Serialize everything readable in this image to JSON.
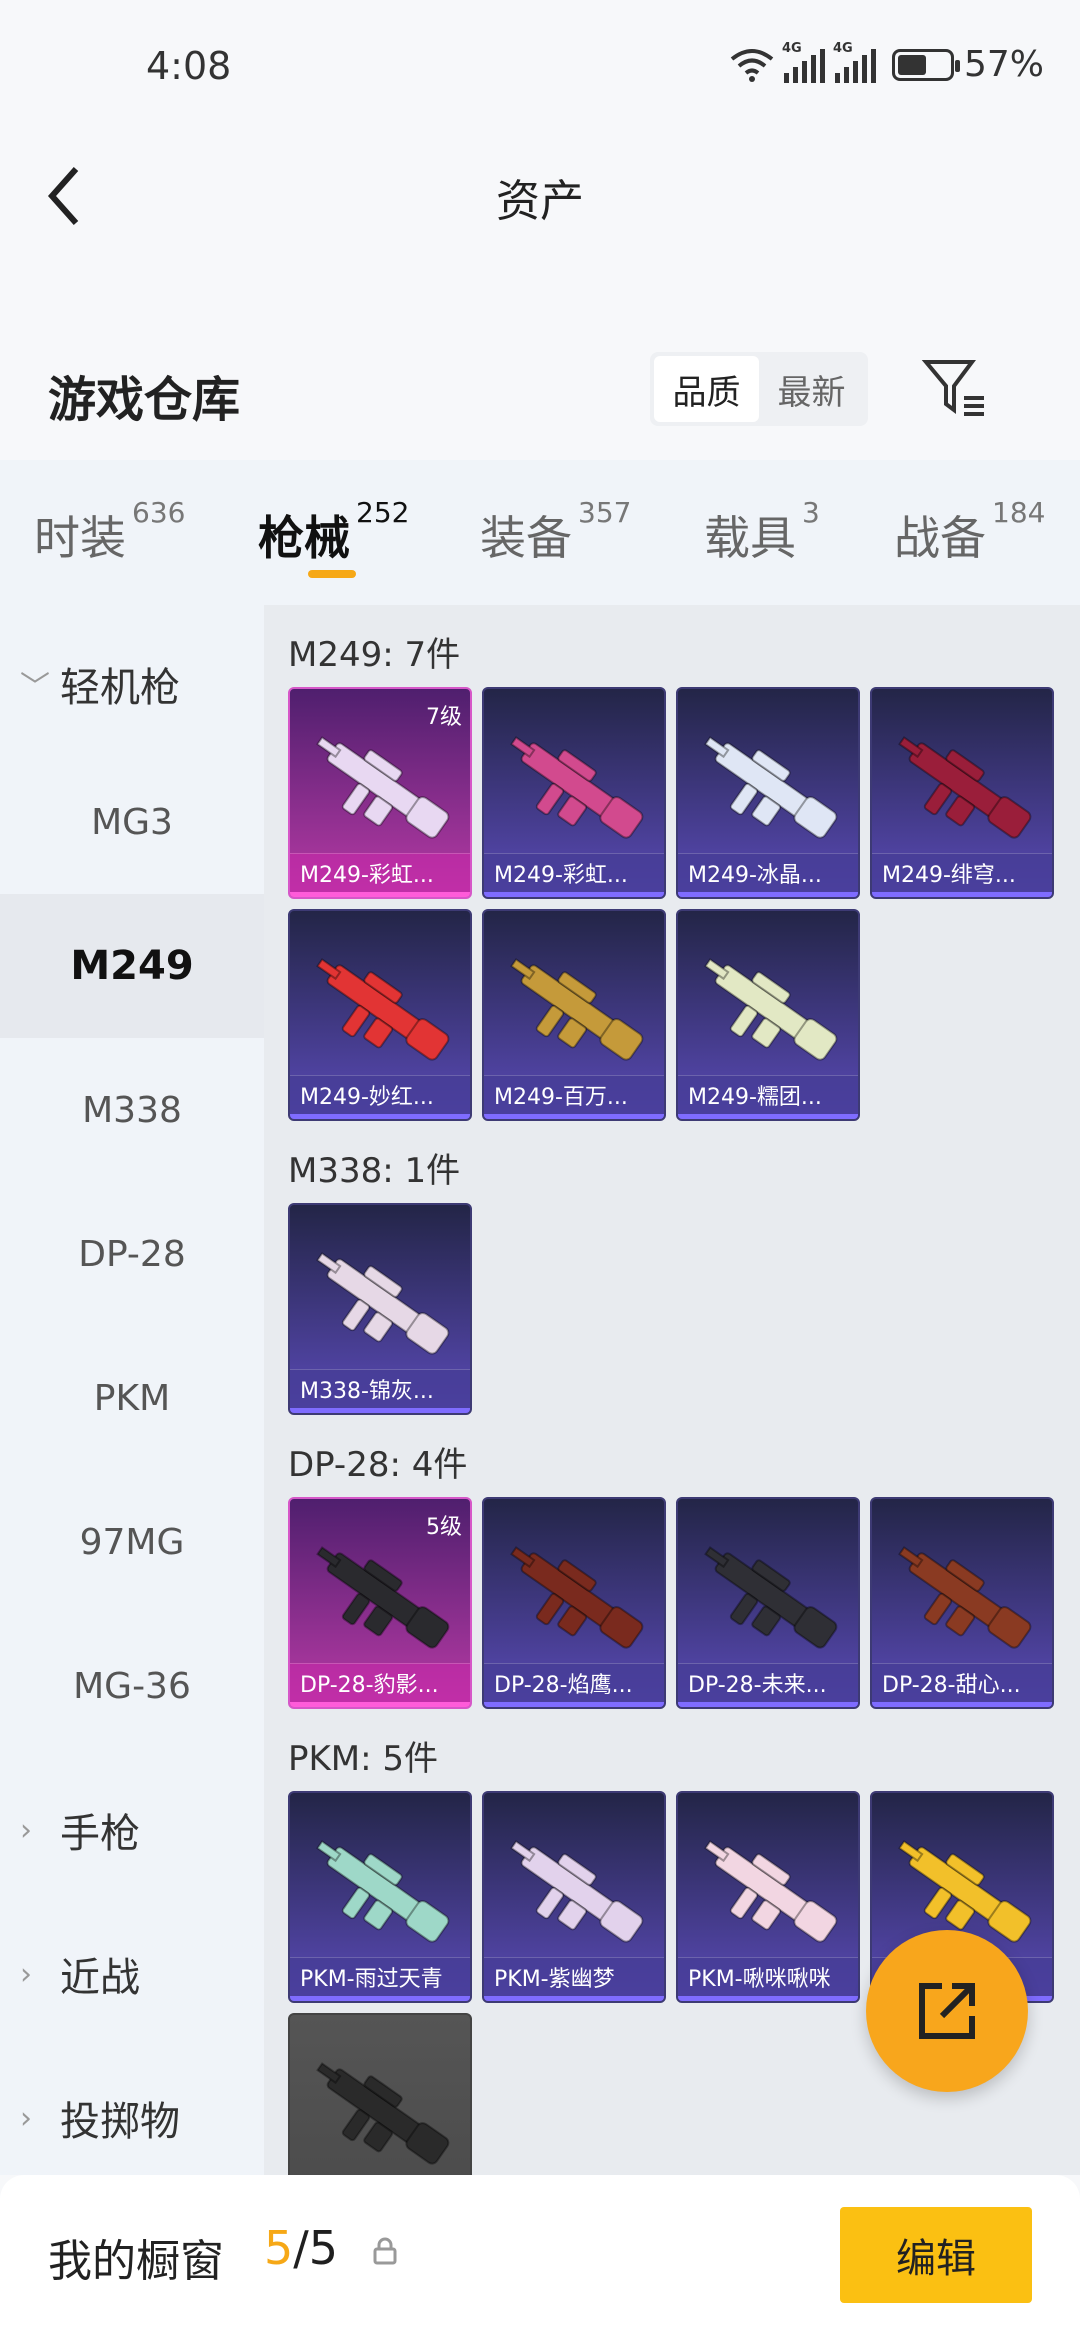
{
  "status": {
    "time": "4:08",
    "net1": "4G",
    "net2": "4G",
    "battery": "57%",
    "battery_level": 0.57
  },
  "header": {
    "title": "资产"
  },
  "warehouse": {
    "title": "游戏仓库",
    "sort_quality": "品质",
    "sort_newest": "最新"
  },
  "tabs": [
    {
      "label": "时装",
      "count": "636"
    },
    {
      "label": "枪械",
      "count": "252"
    },
    {
      "label": "装备",
      "count": "357"
    },
    {
      "label": "载具",
      "count": "3"
    },
    {
      "label": "战备",
      "count": "184"
    }
  ],
  "sidebar": {
    "category_open": "轻机枪",
    "items": [
      "MG3",
      "M249",
      "M338",
      "DP-28",
      "PKM",
      "97MG",
      "MG-36"
    ],
    "selected": "M249",
    "categories_closed": [
      "手枪",
      "近战",
      "投掷物"
    ]
  },
  "groups": [
    {
      "title": "M249: 7件",
      "items": [
        {
          "name": "M249-彩虹...",
          "level": "7级",
          "tier": "legend",
          "color": "#e8d8f2"
        },
        {
          "name": "M249-彩虹...",
          "level": "",
          "tier": "epic",
          "color": "#d24a8e"
        },
        {
          "name": "M249-冰晶...",
          "level": "",
          "tier": "epic",
          "color": "#dfe6f5"
        },
        {
          "name": "M249-绯穹...",
          "level": "",
          "tier": "epic",
          "color": "#9a1e3a"
        },
        {
          "name": "M249-妙红...",
          "level": "",
          "tier": "epic",
          "color": "#e23434"
        },
        {
          "name": "M249-百万...",
          "level": "",
          "tier": "epic",
          "color": "#c59a3a"
        },
        {
          "name": "M249-糯团...",
          "level": "",
          "tier": "epic",
          "color": "#e2e8c4"
        }
      ]
    },
    {
      "title": "M338: 1件",
      "items": [
        {
          "name": "M338-锦灰...",
          "level": "",
          "tier": "epic",
          "color": "#e6d8e6"
        }
      ]
    },
    {
      "title": "DP-28: 4件",
      "items": [
        {
          "name": "DP-28-豹影...",
          "level": "5级",
          "tier": "legend",
          "color": "#2a2a2e"
        },
        {
          "name": "DP-28-焰鹰...",
          "level": "",
          "tier": "epic",
          "color": "#7a2a1e"
        },
        {
          "name": "DP-28-未来...",
          "level": "",
          "tier": "epic",
          "color": "#2f2f35"
        },
        {
          "name": "DP-28-甜心...",
          "level": "",
          "tier": "epic",
          "color": "#8a3a22"
        }
      ]
    },
    {
      "title": "PKM: 5件",
      "items": [
        {
          "name": "PKM-雨过天青",
          "level": "",
          "tier": "epic",
          "color": "#9ed8c8"
        },
        {
          "name": "PKM-紫幽梦",
          "level": "",
          "tier": "epic",
          "color": "#e2d2ec"
        },
        {
          "name": "PKM-啾咪啾咪",
          "level": "",
          "tier": "epic",
          "color": "#f2d6e2"
        },
        {
          "name": "",
          "level": "",
          "tier": "epic",
          "color": "#f2c02a"
        },
        {
          "name": "",
          "level": "",
          "tier": "grey",
          "color": "#2a2a2a"
        }
      ]
    }
  ],
  "bottom": {
    "label": "我的橱窗",
    "count_current": "5",
    "count_sep": "/",
    "count_total": "5",
    "edit": "编辑"
  }
}
